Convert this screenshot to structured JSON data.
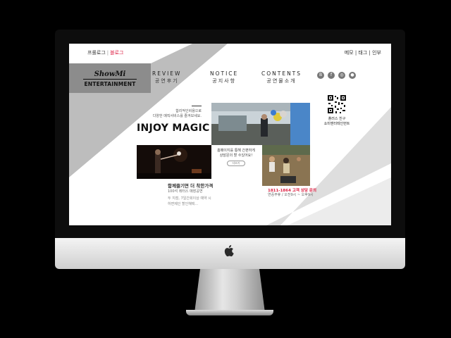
{
  "top_left": {
    "item1": "프롤로그",
    "item2": "블로그"
  },
  "top_right": {
    "item1": "메모",
    "item2": "태그",
    "item3": "인부"
  },
  "logo": {
    "line1": "ShowMi",
    "line2": "ENTERTAINMENT"
  },
  "menu": [
    {
      "en": "REVIEW",
      "ko": "공연후기"
    },
    {
      "en": "NOTICE",
      "ko": "공지사항"
    },
    {
      "en": "CONTENTS",
      "ko": "공연물소개"
    }
  ],
  "social": [
    {
      "icon": "blog-icon",
      "glyph": "B"
    },
    {
      "icon": "facebook-icon",
      "glyph": "f"
    },
    {
      "icon": "instagram-icon",
      "glyph": "◎"
    },
    {
      "icon": "talk-icon",
      "glyph": "●"
    }
  ],
  "intro": {
    "line1": "합리적인비용으로",
    "line2": "다양한 매직서비스를 즐겨보세요."
  },
  "title": "INJOY MAGIC",
  "caption": {
    "title": "함께즐기면 더 착한가격",
    "subtitle": "100석 레터스 매장공연",
    "desc1": "두 지점, 7일간회이상 예약 시",
    "desc2": "하면제인 할인혜택..."
  },
  "mid": {
    "line1": "홈페이지를 통해 간편하게",
    "line2": "상담문의 할 수있어요!",
    "more": "더보기"
  },
  "phone": "1811-1864 고객 상담 문의",
  "phone_sub": "연중무휴 / 오전9시 ~ 오후9시",
  "qr": {
    "line1": "플러스 친구",
    "line2": "쇼미엔터테인먼트"
  },
  "colors": {
    "accent": "#dd2244",
    "band": "#8c8c8c"
  }
}
